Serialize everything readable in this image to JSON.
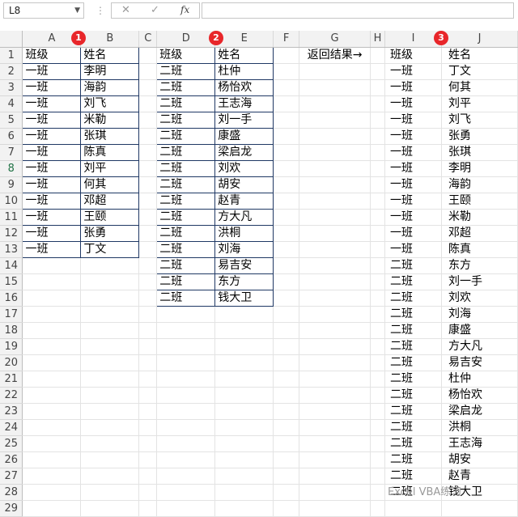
{
  "name_box": "L8",
  "formula_bar": {
    "cancel_icon": "✕",
    "confirm_icon": "✓",
    "fx_label": "fx",
    "formula": ""
  },
  "columns": [
    "A",
    "B",
    "C",
    "D",
    "E",
    "F",
    "G",
    "H",
    "I",
    "J"
  ],
  "rows": [
    1,
    2,
    3,
    4,
    5,
    6,
    7,
    8,
    9,
    10,
    11,
    12,
    13,
    14,
    15,
    16,
    17,
    18,
    19,
    20,
    21,
    22,
    23,
    24,
    25,
    26,
    27,
    28,
    29
  ],
  "selected_row": 8,
  "markers": [
    "1",
    "2",
    "3"
  ],
  "arrow_label": "返回结果→",
  "table1": {
    "headers": [
      "班级",
      "姓名"
    ],
    "rows": [
      [
        "一班",
        "李明"
      ],
      [
        "一班",
        "海韵"
      ],
      [
        "一班",
        "刘飞"
      ],
      [
        "一班",
        "米勒"
      ],
      [
        "一班",
        "张琪"
      ],
      [
        "一班",
        "陈真"
      ],
      [
        "一班",
        "刘平"
      ],
      [
        "一班",
        "何其"
      ],
      [
        "一班",
        "邓超"
      ],
      [
        "一班",
        "王颐"
      ],
      [
        "一班",
        "张勇"
      ],
      [
        "一班",
        "丁文"
      ]
    ]
  },
  "table2": {
    "headers": [
      "班级",
      "姓名"
    ],
    "rows": [
      [
        "二班",
        "杜仲"
      ],
      [
        "二班",
        "杨怡欢"
      ],
      [
        "二班",
        "王志海"
      ],
      [
        "二班",
        "刘一手"
      ],
      [
        "二班",
        "康盛"
      ],
      [
        "二班",
        "梁启龙"
      ],
      [
        "二班",
        "刘欢"
      ],
      [
        "二班",
        "胡安"
      ],
      [
        "二班",
        "赵青"
      ],
      [
        "二班",
        "方大凡"
      ],
      [
        "二班",
        "洪桐"
      ],
      [
        "二班",
        "刘海"
      ],
      [
        "二班",
        "易吉安"
      ],
      [
        "二班",
        "东方"
      ],
      [
        "二班",
        "钱大卫"
      ]
    ]
  },
  "result": {
    "headers": [
      "班级",
      "姓名"
    ],
    "rows": [
      [
        "一班",
        "丁文"
      ],
      [
        "一班",
        "何其"
      ],
      [
        "一班",
        "刘平"
      ],
      [
        "一班",
        "刘飞"
      ],
      [
        "一班",
        "张勇"
      ],
      [
        "一班",
        "张琪"
      ],
      [
        "一班",
        "李明"
      ],
      [
        "一班",
        "海韵"
      ],
      [
        "一班",
        "王颐"
      ],
      [
        "一班",
        "米勒"
      ],
      [
        "一班",
        "邓超"
      ],
      [
        "一班",
        "陈真"
      ],
      [
        "二班",
        "东方"
      ],
      [
        "二班",
        "刘一手"
      ],
      [
        "二班",
        "刘欢"
      ],
      [
        "二班",
        "刘海"
      ],
      [
        "二班",
        "康盛"
      ],
      [
        "二班",
        "方大凡"
      ],
      [
        "二班",
        "易吉安"
      ],
      [
        "二班",
        "杜仲"
      ],
      [
        "二班",
        "杨怡欢"
      ],
      [
        "二班",
        "梁启龙"
      ],
      [
        "二班",
        "洪桐"
      ],
      [
        "二班",
        "王志海"
      ],
      [
        "二班",
        "胡安"
      ],
      [
        "二班",
        "赵青"
      ],
      [
        "二班",
        "钱大卫"
      ]
    ]
  },
  "watermark": "Excel VBA练习"
}
